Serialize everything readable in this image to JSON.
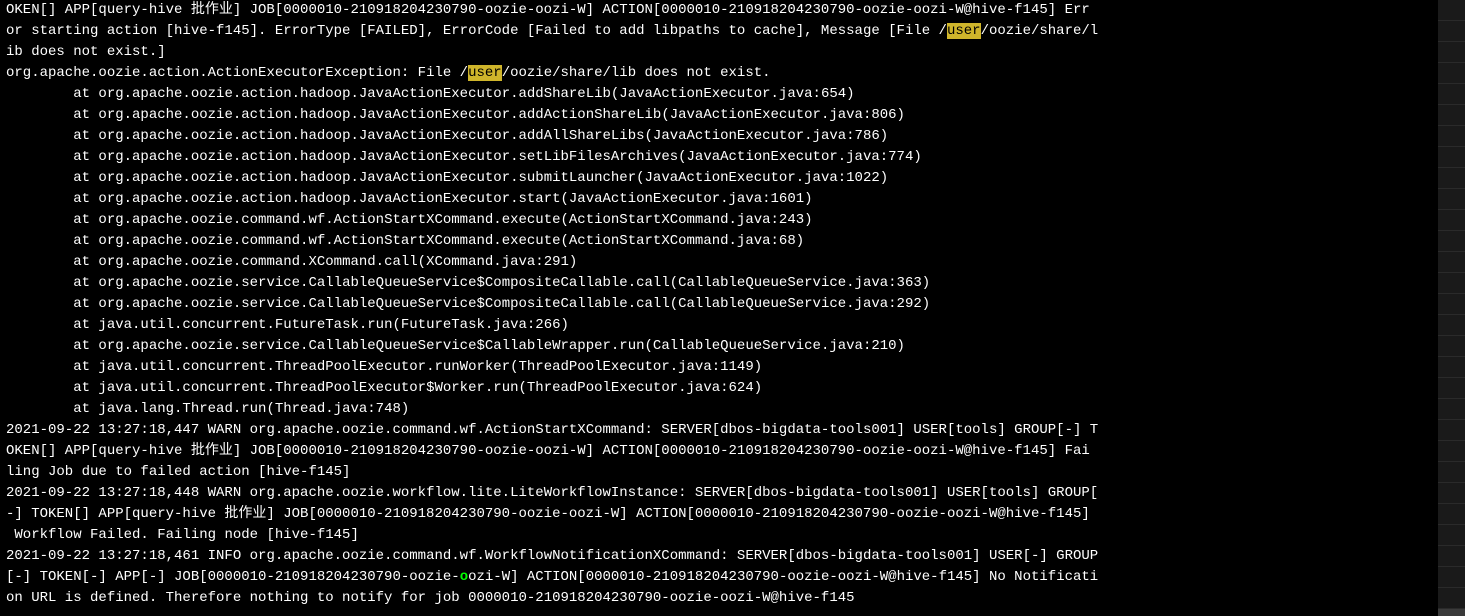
{
  "log_segments": [
    {
      "type": "text",
      "value": "OKEN[] APP[query-hive 批作业] JOB[0000010-210918204230790-oozie-oozi-W] ACTION[0000010-210918204230790-oozie-oozi-W@hive-f145] Err"
    },
    {
      "type": "break"
    },
    {
      "type": "text",
      "value": "or starting action [hive-f145]. ErrorType [FAILED], ErrorCode [Failed to add libpaths to cache], Message [File /"
    },
    {
      "type": "highlight",
      "value": "user"
    },
    {
      "type": "text",
      "value": "/oozie/share/l"
    },
    {
      "type": "break"
    },
    {
      "type": "text",
      "value": "ib does not exist.]"
    },
    {
      "type": "break"
    },
    {
      "type": "text",
      "value": "org.apache.oozie.action.ActionExecutorException: File /"
    },
    {
      "type": "highlight",
      "value": "user"
    },
    {
      "type": "text",
      "value": "/oozie/share/lib does not exist."
    },
    {
      "type": "break"
    },
    {
      "type": "text",
      "value": "        at org.apache.oozie.action.hadoop.JavaActionExecutor.addShareLib(JavaActionExecutor.java:654)"
    },
    {
      "type": "break"
    },
    {
      "type": "text",
      "value": "        at org.apache.oozie.action.hadoop.JavaActionExecutor.addActionShareLib(JavaActionExecutor.java:806)"
    },
    {
      "type": "break"
    },
    {
      "type": "text",
      "value": "        at org.apache.oozie.action.hadoop.JavaActionExecutor.addAllShareLibs(JavaActionExecutor.java:786)"
    },
    {
      "type": "break"
    },
    {
      "type": "text",
      "value": "        at org.apache.oozie.action.hadoop.JavaActionExecutor.setLibFilesArchives(JavaActionExecutor.java:774)"
    },
    {
      "type": "break"
    },
    {
      "type": "text",
      "value": "        at org.apache.oozie.action.hadoop.JavaActionExecutor.submitLauncher(JavaActionExecutor.java:1022)"
    },
    {
      "type": "break"
    },
    {
      "type": "text",
      "value": "        at org.apache.oozie.action.hadoop.JavaActionExecutor.start(JavaActionExecutor.java:1601)"
    },
    {
      "type": "break"
    },
    {
      "type": "text",
      "value": "        at org.apache.oozie.command.wf.ActionStartXCommand.execute(ActionStartXCommand.java:243)"
    },
    {
      "type": "break"
    },
    {
      "type": "text",
      "value": "        at org.apache.oozie.command.wf.ActionStartXCommand.execute(ActionStartXCommand.java:68)"
    },
    {
      "type": "break"
    },
    {
      "type": "text",
      "value": "        at org.apache.oozie.command.XCommand.call(XCommand.java:291)"
    },
    {
      "type": "break"
    },
    {
      "type": "text",
      "value": "        at org.apache.oozie.service.CallableQueueService$CompositeCallable.call(CallableQueueService.java:363)"
    },
    {
      "type": "break"
    },
    {
      "type": "text",
      "value": "        at org.apache.oozie.service.CallableQueueService$CompositeCallable.call(CallableQueueService.java:292)"
    },
    {
      "type": "break"
    },
    {
      "type": "text",
      "value": "        at java.util.concurrent.FutureTask.run(FutureTask.java:266)"
    },
    {
      "type": "break"
    },
    {
      "type": "text",
      "value": "        at org.apache.oozie.service.CallableQueueService$CallableWrapper.run(CallableQueueService.java:210)"
    },
    {
      "type": "break"
    },
    {
      "type": "text",
      "value": "        at java.util.concurrent.ThreadPoolExecutor.runWorker(ThreadPoolExecutor.java:1149)"
    },
    {
      "type": "break"
    },
    {
      "type": "text",
      "value": "        at java.util.concurrent.ThreadPoolExecutor$Worker.run(ThreadPoolExecutor.java:624)"
    },
    {
      "type": "break"
    },
    {
      "type": "text",
      "value": "        at java.lang.Thread.run(Thread.java:748)"
    },
    {
      "type": "break"
    },
    {
      "type": "text",
      "value": "2021-09-22 13:27:18,447 WARN org.apache.oozie.command.wf.ActionStartXCommand: SERVER[dbos-bigdata-tools001] USER[tools] GROUP[-] T"
    },
    {
      "type": "break"
    },
    {
      "type": "text",
      "value": "OKEN[] APP[query-hive 批作业] JOB[0000010-210918204230790-oozie-oozi-W] ACTION[0000010-210918204230790-oozie-oozi-W@hive-f145] Fai"
    },
    {
      "type": "break"
    },
    {
      "type": "text",
      "value": "ling Job due to failed action [hive-f145]"
    },
    {
      "type": "break"
    },
    {
      "type": "text",
      "value": "2021-09-22 13:27:18,448 WARN org.apache.oozie.workflow.lite.LiteWorkflowInstance: SERVER[dbos-bigdata-tools001] USER[tools] GROUP["
    },
    {
      "type": "break"
    },
    {
      "type": "text",
      "value": "-] TOKEN[] APP[query-hive 批作业] JOB[0000010-210918204230790-oozie-oozi-W] ACTION[0000010-210918204230790-oozie-oozi-W@hive-f145]"
    },
    {
      "type": "break"
    },
    {
      "type": "text",
      "value": " Workflow Failed. Failing node [hive-f145]"
    },
    {
      "type": "break"
    },
    {
      "type": "text",
      "value": "2021-09-22 13:27:18,461 INFO org.apache.oozie.command.wf.WorkflowNotificationXCommand: SERVER[dbos-bigdata-tools001] USER[-] GROUP"
    },
    {
      "type": "break"
    },
    {
      "type": "text",
      "value": "[-] TOKEN[-] APP[-] JOB[0000010-210918204230790-oozie-"
    },
    {
      "type": "cursor",
      "value": "o"
    },
    {
      "type": "text",
      "value": "ozi-W] ACTION[0000010-210918204230790-oozie-oozi-W@hive-f145] No Notificati"
    },
    {
      "type": "break"
    },
    {
      "type": "text",
      "value": "on URL is defined. Therefore nothing to notify for job 0000010-210918204230790-oozie-oozi-W@hive-f145"
    }
  ],
  "scrollbar": {
    "segments": 29
  }
}
